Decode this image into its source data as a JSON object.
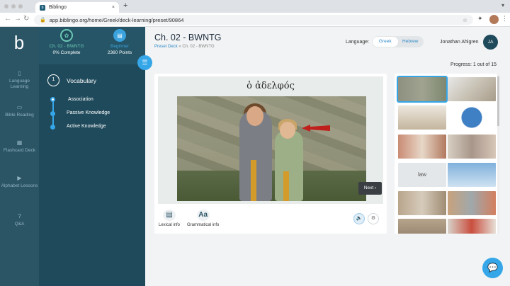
{
  "browser": {
    "tab_title": "Biblingo",
    "tab_close": "×",
    "new_tab": "+",
    "url": "app.biblingo.org/home/Greek/deck-learning/preset/90864"
  },
  "sidebar": {
    "logo": "b",
    "items": [
      {
        "icon": "book-icon",
        "label": "Language Learning"
      },
      {
        "icon": "bible-icon",
        "label": "Bible Reading"
      },
      {
        "icon": "flashcard-icon",
        "label": "Flashcard Deck"
      },
      {
        "icon": "play-icon",
        "label": "Alphabet Lessons"
      },
      {
        "icon": "question-icon",
        "label": "Q&A"
      }
    ]
  },
  "deck_panel": {
    "deck_name": "Ch. 02 - BWNTG",
    "completion": "0% Complete",
    "level": "Beginner",
    "points": "2360 Points",
    "section_number": "1",
    "section_title": "Vocabulary",
    "steps": [
      "Association",
      "Passive Knowledge",
      "Active Knowledge"
    ]
  },
  "header": {
    "title": "Ch. 02 - BWNTG",
    "breadcrumb_link": "Preset Deck",
    "breadcrumb_sep": "»",
    "breadcrumb_current": "Ch. 02 - BWNTG",
    "language_label": "Language:",
    "languages": [
      "Greek",
      "Hebrew"
    ],
    "selected_language": "Greek",
    "user_name": "Jonathan Ahlgren",
    "user_initials": "JA"
  },
  "progress_text": "Progress: 1 out of 15",
  "card": {
    "word": "ὁ ἀδελφός",
    "next_label": "Next",
    "lexical_label": "Lexical info",
    "grammatical_label": "Grammatical info",
    "grammatical_icon_text": "Aa"
  },
  "grid": {
    "text_tile": "law"
  },
  "colors": {
    "rail": "#2b5465",
    "panel": "#1f4a5b",
    "accent": "#35a6e8",
    "teal": "#6dc8b5"
  }
}
